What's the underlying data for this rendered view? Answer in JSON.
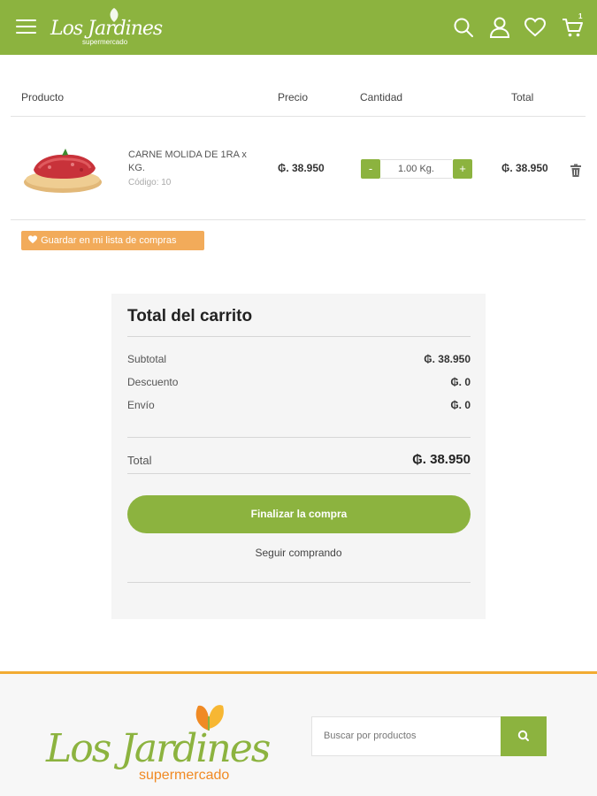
{
  "header": {
    "logo_name": "Los Jardines",
    "logo_sub": "supermercado",
    "cart_count": "1",
    "colors": {
      "brand_green": "#8cb33f",
      "accent_orange": "#f2ab5a"
    },
    "icons": [
      "menu-icon",
      "search-icon",
      "user-icon",
      "heart-icon",
      "cart-icon"
    ]
  },
  "table": {
    "columns": [
      "Producto",
      "Precio",
      "Cantidad",
      "Total"
    ]
  },
  "item": {
    "name": "CARNE MOLIDA DE 1RA x KG.",
    "code": "Código: 10",
    "price": "₲. 38.950",
    "quantity": "1.00  Kg.",
    "minus": "-",
    "plus": "+",
    "total": "₲. 38.950"
  },
  "save_list_label": "Guardar en mi lista de compras",
  "cart_totals": {
    "title": "Total del carrito",
    "rows": [
      {
        "label": "Subtotal",
        "value": "₲. 38.950"
      },
      {
        "label": "Descuento",
        "value": "₲. 0"
      },
      {
        "label": "Envío",
        "value": "₲. 0"
      }
    ],
    "total_label": "Total",
    "total_value": "₲. 38.950",
    "checkout_label": "Finalizar la compra",
    "continue_label": "Seguir comprando"
  },
  "footer": {
    "logo_name": "Los Jardines",
    "logo_sub": "supermercado",
    "search_placeholder": "Buscar por productos"
  }
}
